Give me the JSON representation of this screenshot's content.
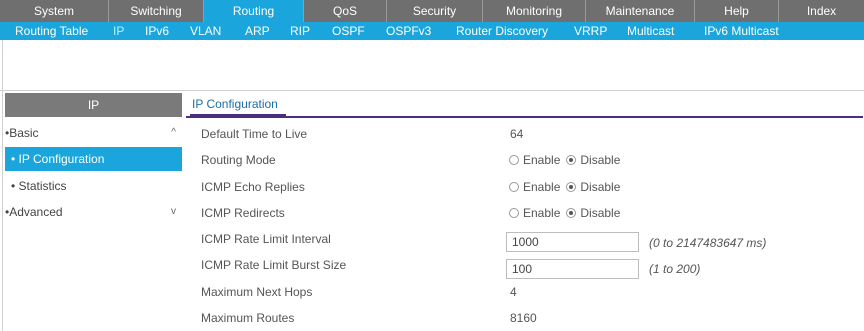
{
  "top_tabs": [
    {
      "label": "System",
      "active": false
    },
    {
      "label": "Switching",
      "active": false
    },
    {
      "label": "Routing",
      "active": true
    },
    {
      "label": "QoS",
      "active": false
    },
    {
      "label": "Security",
      "active": false
    },
    {
      "label": "Monitoring",
      "active": false
    },
    {
      "label": "Maintenance",
      "active": false
    },
    {
      "label": "Help",
      "active": false
    },
    {
      "label": "Index",
      "active": false
    }
  ],
  "sub_tabs": [
    {
      "label": "Routing Table",
      "active": false
    },
    {
      "label": "IP",
      "active": true
    },
    {
      "label": "IPv6",
      "active": false
    },
    {
      "label": "VLAN",
      "active": false
    },
    {
      "label": "ARP",
      "active": false
    },
    {
      "label": "RIP",
      "active": false
    },
    {
      "label": "OSPF",
      "active": false
    },
    {
      "label": "OSPFv3",
      "active": false
    },
    {
      "label": "Router Discovery",
      "active": false
    },
    {
      "label": "VRRP",
      "active": false
    },
    {
      "label": "Multicast",
      "active": false
    },
    {
      "label": "IPv6 Multicast",
      "active": false
    }
  ],
  "sidebar": {
    "header": "IP",
    "items": [
      {
        "label": "•Basic",
        "chevron": "^",
        "active": false
      },
      {
        "label": "• IP Configuration",
        "chevron": "",
        "active": true
      },
      {
        "label": "• Statistics",
        "chevron": "",
        "active": false
      },
      {
        "label": "•Advanced",
        "chevron": "v",
        "active": false
      }
    ]
  },
  "main": {
    "title": "IP Configuration",
    "rows": {
      "ttl": {
        "label": "Default Time to Live",
        "value": "64"
      },
      "routing_mode": {
        "label": "Routing Mode",
        "enable": "Enable",
        "disable": "Disable",
        "selected": "Disable"
      },
      "icmp_echo": {
        "label": "ICMP Echo Replies",
        "enable": "Enable",
        "disable": "Disable",
        "selected": "Disable"
      },
      "icmp_redirects": {
        "label": "ICMP Redirects",
        "enable": "Enable",
        "disable": "Disable",
        "selected": "Disable"
      },
      "rate_interval": {
        "label": "ICMP Rate Limit Interval",
        "value": "1000",
        "hint": "(0 to 2147483647 ms)"
      },
      "rate_burst": {
        "label": "ICMP Rate Limit Burst Size",
        "value": "100",
        "hint": "(1 to 200)"
      },
      "next_hops": {
        "label": "Maximum Next Hops",
        "value": "4"
      },
      "max_routes": {
        "label": "Maximum Routes",
        "value": "8160"
      }
    }
  },
  "colors": {
    "accent": "#1aa5dc",
    "nav_bg": "#6f6f6f",
    "title_rule": "#4b2f7f"
  }
}
